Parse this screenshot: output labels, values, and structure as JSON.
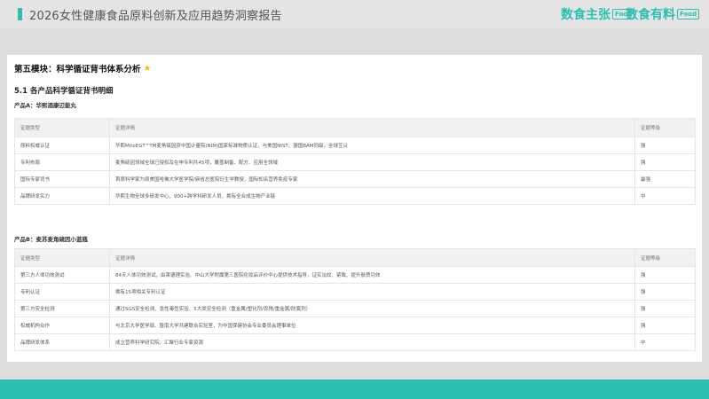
{
  "header": {
    "report_title": "2026女性健康食品原料创新及应用趋势洞察报告",
    "brand_1": {
      "name": "数食主张",
      "badge": "Food"
    },
    "brand_2": {
      "name": "数食有料",
      "badge": "Food"
    }
  },
  "content": {
    "module_title": "第五模块：科学循证背书体系分析",
    "star_icon": "star-icon",
    "section_title": "5.1 各产品科学循证背书明细",
    "product_a": {
      "label": "产品A：华熙酒康辺能丸",
      "headers": [
        "证据类型",
        "证据详情",
        "证据等级"
      ],
      "rows": [
        [
          "原料权威认证",
          "华熙MitoEGT^TM麦角硫因获中国计量院(NIM)国家标准物质认证，与美国NIST、德国BAM同级，全球互认",
          "强"
        ],
        [
          "专利布局",
          "麦角硫因领域全球已授权及在申专利共45项，覆盖制备、配方、应用全领域",
          "强"
        ],
        [
          "国际专家背书",
          "首席科学家为原美国哈佛大学医学院/麻省总医院衍生学教授，国际知名营养免疫专家",
          "最强"
        ],
        [
          "品牌研发实力",
          "华熙生物全球多研发中心，900+跨学科研发人员，拥有全合成生物产业链",
          "中"
        ]
      ]
    },
    "product_b": {
      "label": "产品B：麦苏麦角硫因小蓝瓶",
      "headers": [
        "证据类型",
        "证据详情",
        "证据等级"
      ],
      "rows": [
        [
          "第三方人体功效测试",
          "84天人体功效测试，由莱德理实验、中山大学附属第三医院化妆品评价中心提供技术指导，证实淡纹、紧致、提升肤质功效",
          "强"
        ],
        [
          "专利认证",
          "拥有15项相关专利认证",
          "强"
        ],
        [
          "第三方安全检测",
          "通过SGS安全检测、急性毒性实验、5大类安全检测（重金属/塑化剂/农残/重金属/防腐剂）",
          "强"
        ],
        [
          "权威机构合作",
          "与北京大学医学部、暨南大学共建联合实验室，为中国保健协会专业委员会理事单位",
          "强"
        ],
        [
          "品牌研发体系",
          "成立营养科学研究院，汇聚行业专家资源",
          "中"
        ]
      ]
    }
  }
}
